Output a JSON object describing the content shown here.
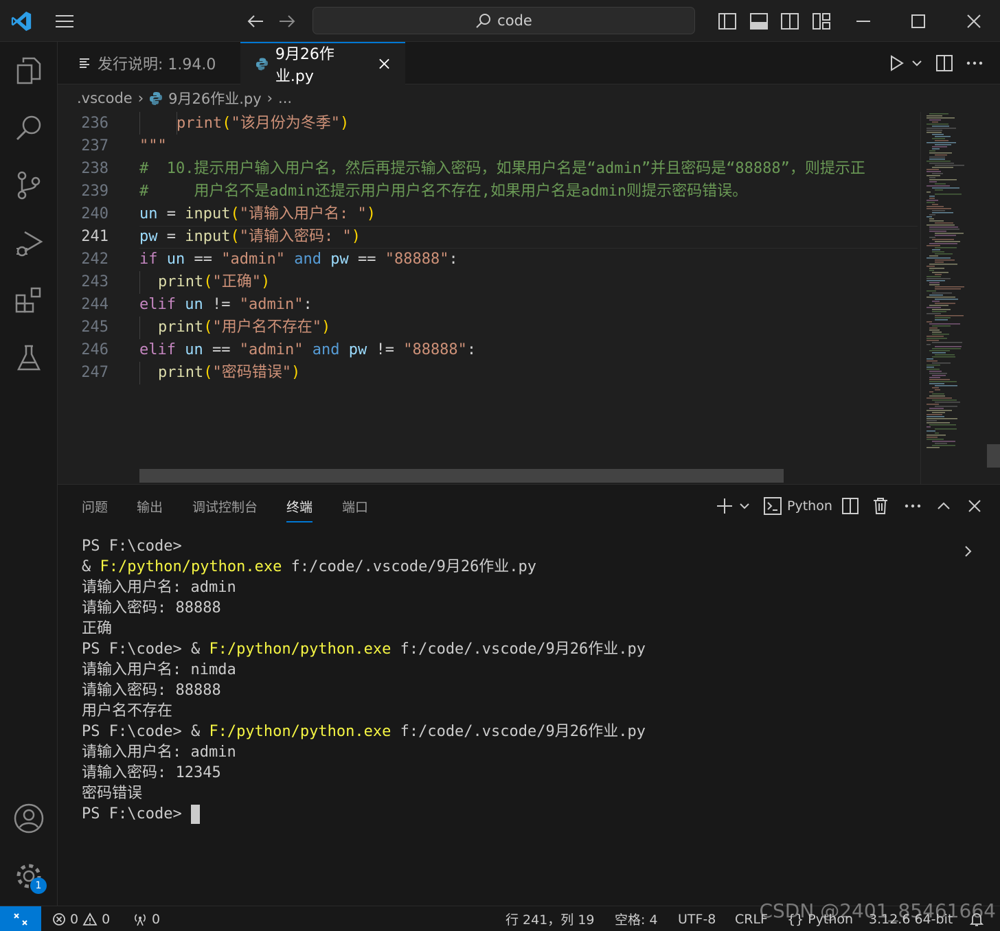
{
  "titlebar": {
    "search_text": "code"
  },
  "tabs": {
    "release_notes": "发行说明: 1.94.0",
    "active_file": "9月26作业.py"
  },
  "breadcrumb": {
    "folder": ".vscode",
    "file": "9月26作业.py",
    "more": "..."
  },
  "editor": {
    "active_line": 241,
    "lines": [
      {
        "n": "236",
        "text": "print(\"该月份为冬季\")"
      },
      {
        "n": "237",
        "text": "\"\"\""
      },
      {
        "n": "238",
        "text": "#  10.提示用户输入用户名，然后再提示输入密码，如果用户名是“admin”并且密码是“88888”，则提示正"
      },
      {
        "n": "239",
        "text": "#     用户名不是admin还提示用户用户名不存在,如果用户名是admin则提示密码错误。"
      },
      {
        "n": "240",
        "text": "un = input(\"请输入用户名: \")"
      },
      {
        "n": "241",
        "text": "pw = input(\"请输入密码: \")"
      },
      {
        "n": "242",
        "text": "if un == \"admin\" and pw == \"88888\":"
      },
      {
        "n": "243",
        "text": "print(\"正确\")"
      },
      {
        "n": "244",
        "text": "elif un != \"admin\":"
      },
      {
        "n": "245",
        "text": "print(\"用户名不存在\")"
      },
      {
        "n": "246",
        "text": "elif un == \"admin\" and pw != \"88888\":"
      },
      {
        "n": "247",
        "text": "print(\"密码错误\")"
      }
    ]
  },
  "panel": {
    "tabs": [
      "问题",
      "输出",
      "调试控制台",
      "终端",
      "端口"
    ],
    "active_tab": "终端",
    "shell_label": "Python"
  },
  "terminal": {
    "lines": [
      "PS F:\\code>",
      "& F:/python/python.exe f:/code/.vscode/9月26作业.py",
      "请输入用户名: admin",
      "请输入密码: 88888",
      "正确",
      "PS F:\\code> & F:/python/python.exe f:/code/.vscode/9月26作业.py",
      "请输入用户名: nimda",
      "请输入密码: 88888",
      "用户名不存在",
      "PS F:\\code> & F:/python/python.exe f:/code/.vscode/9月26作业.py",
      "请输入用户名: admin",
      "请输入密码: 12345",
      "密码错误",
      "PS F:\\code> "
    ]
  },
  "statusbar": {
    "errors": "0",
    "warnings": "0",
    "ports": "0",
    "position": "行 241，列 19",
    "indent": "空格: 4",
    "encoding": "UTF-8",
    "eol": "CRLF",
    "language": "{} Python",
    "interpreter": "3.12.6 64-bit",
    "settings_badge": "1"
  },
  "watermark": "CSDN @2401_85461664",
  "colors": {
    "accent": "#0078d4",
    "keyword": "#c586c0",
    "function": "#dcdcaa",
    "string": "#ce9178",
    "variable": "#9cdcfe",
    "comment": "#6a9955"
  }
}
